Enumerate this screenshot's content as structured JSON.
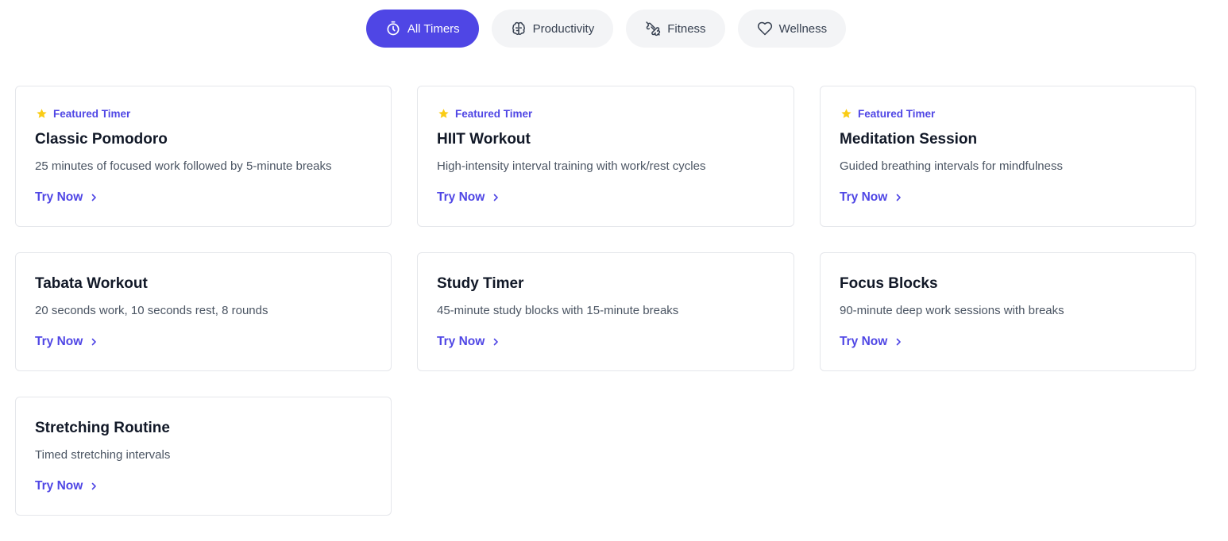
{
  "filters": [
    {
      "label": "All Timers",
      "icon": "stopwatch-icon",
      "active": true
    },
    {
      "label": "Productivity",
      "icon": "brain-icon",
      "active": false
    },
    {
      "label": "Fitness",
      "icon": "dumbbell-icon",
      "active": false
    },
    {
      "label": "Wellness",
      "icon": "heart-icon",
      "active": false
    }
  ],
  "colors": {
    "accent": "#4f46e5",
    "star": "#facc15",
    "chip_bg": "#f3f4f6",
    "border": "#e5e7eb"
  },
  "cards": [
    {
      "badge": "Featured Timer",
      "title": "Classic Pomodoro",
      "description": "25 minutes of focused work followed by 5-minute breaks",
      "link": "Try Now"
    },
    {
      "badge": "Featured Timer",
      "title": "HIIT Workout",
      "description": "High-intensity interval training with work/rest cycles",
      "link": "Try Now"
    },
    {
      "badge": "Featured Timer",
      "title": "Meditation Session",
      "description": "Guided breathing intervals for mindfulness",
      "link": "Try Now"
    },
    {
      "title": "Tabata Workout",
      "description": "20 seconds work, 10 seconds rest, 8 rounds",
      "link": "Try Now"
    },
    {
      "title": "Study Timer",
      "description": "45-minute study blocks with 15-minute breaks",
      "link": "Try Now"
    },
    {
      "title": "Focus Blocks",
      "description": "90-minute deep work sessions with breaks",
      "link": "Try Now"
    },
    {
      "title": "Stretching Routine",
      "description": "Timed stretching intervals",
      "link": "Try Now"
    }
  ]
}
